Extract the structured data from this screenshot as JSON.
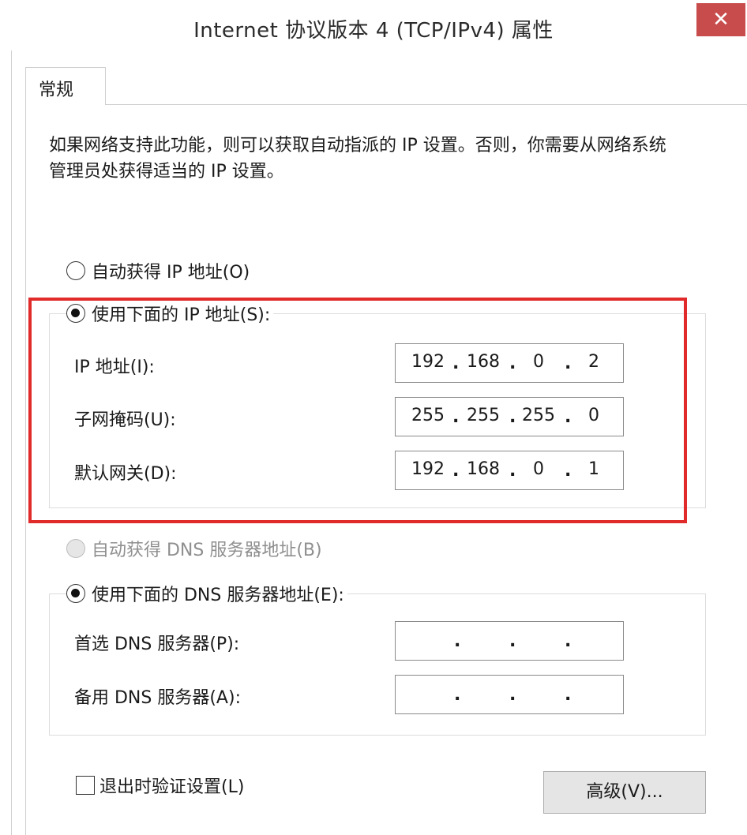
{
  "window": {
    "title": "Internet 协议版本 4 (TCP/IPv4) 属性",
    "close_label": "✕"
  },
  "tabs": {
    "general": "常规"
  },
  "description": "如果网络支持此功能，则可以获取自动指派的 IP 设置。否则，你需要从网络系统管理员处获得适当的 IP 设置。",
  "ip_settings": {
    "auto_label": "自动获得 IP 地址(O)",
    "manual_label": "使用下面的 IP 地址(S):",
    "selected": "manual",
    "ip_address": {
      "label": "IP 地址(I):",
      "octets": [
        "192",
        "168",
        "0",
        "2"
      ]
    },
    "subnet_mask": {
      "label": "子网掩码(U):",
      "octets": [
        "255",
        "255",
        "255",
        "0"
      ]
    },
    "gateway": {
      "label": "默认网关(D):",
      "octets": [
        "192",
        "168",
        "0",
        "1"
      ]
    }
  },
  "dns_settings": {
    "auto_label": "自动获得 DNS 服务器地址(B)",
    "manual_label": "使用下面的 DNS 服务器地址(E):",
    "selected": "manual",
    "preferred": {
      "label": "首选 DNS 服务器(P):",
      "octets": [
        "",
        "",
        "",
        ""
      ]
    },
    "alternate": {
      "label": "备用 DNS 服务器(A):",
      "octets": [
        "",
        "",
        "",
        ""
      ]
    }
  },
  "validate_on_exit": {
    "label": "退出时验证设置(L)",
    "checked": false
  },
  "advanced_button": "高级(V)...",
  "colors": {
    "highlight": "#e12a2a",
    "close_button": "#c94c4c"
  }
}
